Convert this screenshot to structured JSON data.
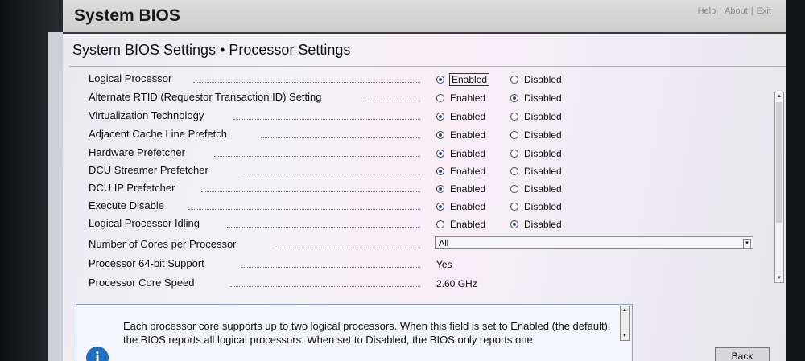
{
  "window": {
    "title": "System BIOS",
    "links": [
      "Help",
      "About",
      "Exit"
    ]
  },
  "page": {
    "heading": "System BIOS Settings • Processor Settings"
  },
  "options": {
    "enabled": "Enabled",
    "disabled": "Disabled"
  },
  "settings": [
    {
      "label": "Logical Processor",
      "value": "Enabled"
    },
    {
      "label": "Alternate RTID (Requestor Transaction ID) Setting",
      "value": "Disabled"
    },
    {
      "label": "Virtualization Technology",
      "value": "Enabled"
    },
    {
      "label": "Adjacent Cache Line Prefetch",
      "value": "Enabled"
    },
    {
      "label": "Hardware Prefetcher",
      "value": "Enabled"
    },
    {
      "label": "DCU Streamer Prefetcher",
      "value": "Enabled"
    },
    {
      "label": "DCU IP Prefetcher",
      "value": "Enabled"
    },
    {
      "label": "Execute Disable",
      "value": "Enabled"
    },
    {
      "label": "Logical Processor Idling",
      "value": "Disabled"
    }
  ],
  "cores": {
    "label": "Number of Cores per Processor",
    "value": "All"
  },
  "support64": {
    "label": "Processor 64-bit Support",
    "value": "Yes"
  },
  "speed": {
    "label": "Processor Core Speed",
    "value": "2.60 GHz"
  },
  "help": {
    "text": "Each processor core supports up to two logical processors. When this field is set to Enabled (the default), the BIOS reports all logical processors. When set to Disabled, the BIOS only reports one"
  },
  "footer": {
    "back": "Back"
  }
}
